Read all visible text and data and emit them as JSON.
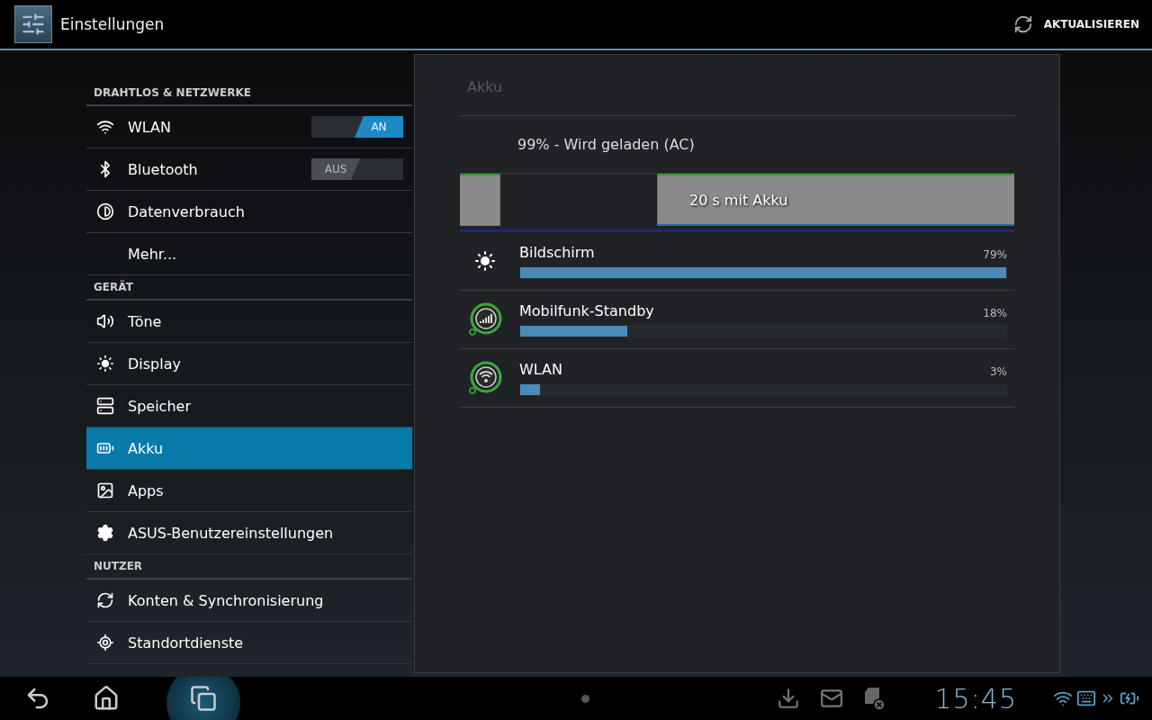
{
  "action_bar": {
    "title": "Einstellungen",
    "action": "AKTUALISIEREN"
  },
  "sidebar": {
    "sections": [
      {
        "header": "DRAHTLOS & NETZWERKE",
        "items": [
          {
            "label": "WLAN",
            "kind": "toggle",
            "on": true,
            "toggle_label": "AN",
            "selected": false
          },
          {
            "label": "Bluetooth",
            "kind": "toggle",
            "on": false,
            "toggle_label": "AUS",
            "selected": false
          },
          {
            "label": "Datenverbrauch",
            "kind": "plain",
            "selected": false
          },
          {
            "label": "Mehr...",
            "kind": "plain",
            "selected": false
          }
        ]
      },
      {
        "header": "GERÄT",
        "items": [
          {
            "label": "Töne",
            "kind": "plain",
            "selected": false
          },
          {
            "label": "Display",
            "kind": "plain",
            "selected": false
          },
          {
            "label": "Speicher",
            "kind": "plain",
            "selected": false
          },
          {
            "label": "Akku",
            "kind": "plain",
            "selected": true
          },
          {
            "label": "Apps",
            "kind": "plain",
            "selected": false
          },
          {
            "label": "ASUS-Benutzereinstellungen",
            "kind": "plain",
            "selected": false
          }
        ]
      },
      {
        "header": "NUTZER",
        "items": [
          {
            "label": "Konten & Synchronisierung",
            "kind": "plain",
            "selected": false
          },
          {
            "label": "Standortdienste",
            "kind": "plain",
            "selected": false
          }
        ]
      }
    ]
  },
  "detail": {
    "title": "Akku",
    "status": "99% - Wird geladen (AC)",
    "graph_label": "20 s mit Akku",
    "usage": [
      {
        "name": "Bildschirm",
        "percent": "79%",
        "level": 1.0
      },
      {
        "name": "Mobilfunk-Standby",
        "percent": "18%",
        "level": 0.22
      },
      {
        "name": "WLAN",
        "percent": "3%",
        "level": 0.04
      }
    ]
  },
  "nav_bar": {
    "time": "15:45"
  }
}
